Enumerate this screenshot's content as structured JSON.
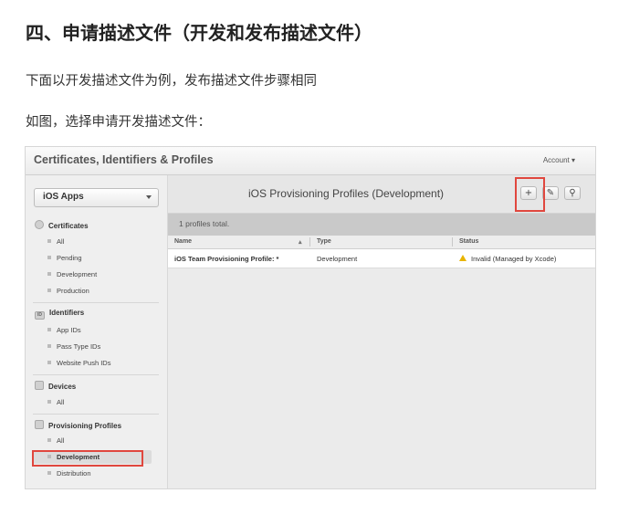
{
  "heading": "四、申请描述文件（开发和发布描述文件）",
  "para1": "下面以开发描述文件为例，发布描述文件步骤相同",
  "para2": "如图，选择申请开发描述文件：",
  "screenshot": {
    "app_title": "Certificates, Identifiers & Profiles",
    "account_label": "Account ▾",
    "platform_select": "iOS Apps",
    "sidebar": {
      "certificates": {
        "label": "Certificates",
        "items": [
          "All",
          "Pending",
          "Development",
          "Production"
        ]
      },
      "identifiers": {
        "label": "Identifiers",
        "icon_text": "ID",
        "items": [
          "App IDs",
          "Pass Type IDs",
          "Website Push IDs"
        ]
      },
      "devices": {
        "label": "Devices",
        "items": [
          "All"
        ]
      },
      "provisioning": {
        "label": "Provisioning Profiles",
        "items": [
          "All",
          "Development",
          "Distribution"
        ],
        "active_index": 1
      }
    },
    "page_title": "iOS Provisioning Profiles (Development)",
    "toolbar": {
      "add": "+",
      "edit": "✎",
      "search": "⚲"
    },
    "count_text": "1 profiles total.",
    "table": {
      "columns": [
        "Name",
        "Type",
        "Status"
      ],
      "sort_indicator": "▴",
      "rows": [
        {
          "name": "iOS Team Provisioning Profile: *",
          "type": "Development",
          "status": "Invalid (Managed by Xcode)"
        }
      ]
    },
    "colors": {
      "highlight_red": "#e0473e",
      "warning_yellow": "#e8b400"
    }
  }
}
